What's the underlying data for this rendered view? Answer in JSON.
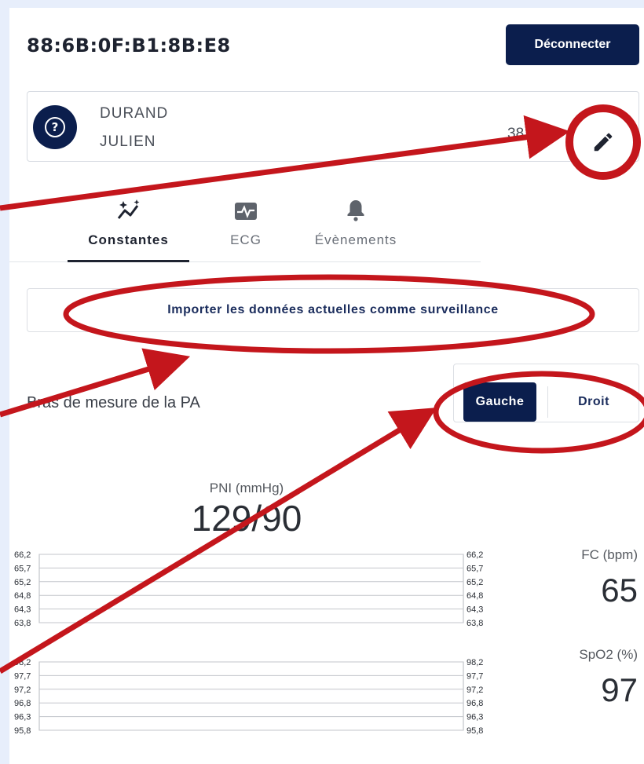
{
  "device": {
    "id": "88:6B:0F:B1:8B:E8",
    "disconnect_label": "Déconnecter"
  },
  "patient": {
    "last_name": "DURAND",
    "first_name": "JULIEN",
    "age": "38 ans"
  },
  "icons": {
    "avatar": "question-circle-icon",
    "edit": "pencil-icon"
  },
  "tabs": [
    {
      "label": "Constantes",
      "icon": "sparkle-chart-icon",
      "active": true
    },
    {
      "label": "ECG",
      "icon": "ecg-monitor-icon",
      "active": false
    },
    {
      "label": "Évènements",
      "icon": "bell-icon",
      "active": false
    }
  ],
  "import_label": "Importer les données actuelles comme surveillance",
  "arm": {
    "label": "Bras de mesure de la PA",
    "left": "Gauche",
    "right": "Droit",
    "selected": "Gauche"
  },
  "pni": {
    "label": "PNI (mmHg)",
    "value": "129/90"
  },
  "fc": {
    "label": "FC (bpm)",
    "value": "65"
  },
  "spo2": {
    "label": "SpO2 (%)",
    "value": "97"
  },
  "colors": {
    "navy": "#0b1e4d",
    "annotation_red": "#c4161c"
  },
  "chart_data": [
    {
      "type": "line",
      "series": [],
      "ticks": [
        "66,2",
        "65,7",
        "65,2",
        "64,8",
        "64,3",
        "63,8"
      ],
      "ylim": [
        63.8,
        66.2
      ]
    },
    {
      "type": "line",
      "series": [],
      "ticks": [
        "98,2",
        "97,7",
        "97,2",
        "96,8",
        "96,3",
        "95,8"
      ],
      "ylim": [
        95.8,
        98.2
      ]
    }
  ]
}
